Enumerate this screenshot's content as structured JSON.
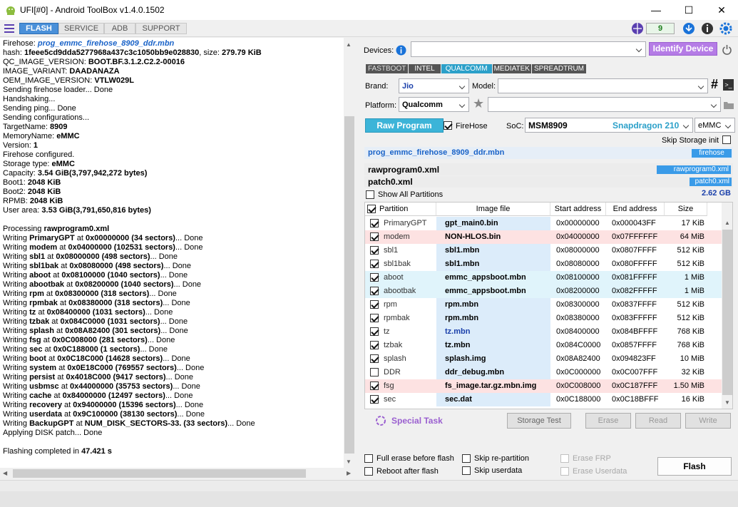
{
  "window": {
    "title": "UFI[#0] - Android ToolBox v1.4.0.1502",
    "controls": [
      "—",
      "☐",
      "✕"
    ]
  },
  "tabs": [
    "FLASH",
    "SERVICE",
    "ADB",
    "SUPPORT"
  ],
  "counter": "9",
  "log": [
    [
      [
        "Firehose: ",
        0
      ],
      [
        "prog_emmc_firehose_8909_ddr.mbn",
        2
      ]
    ],
    [
      [
        " hash: ",
        0
      ],
      [
        "1feee5cd9dda5277968a437c3c1050bb9e028830",
        1
      ],
      [
        ", size: ",
        0
      ],
      [
        "279.79 KiB",
        1
      ]
    ],
    [
      [
        " QC_IMAGE_VERSION: ",
        0
      ],
      [
        "BOOT.BF.3.1.2.C2.2-00016",
        1
      ]
    ],
    [
      [
        " IMAGE_VARIANT: ",
        0
      ],
      [
        "DAADANAZA",
        1
      ]
    ],
    [
      [
        " OEM_IMAGE_VERSION: ",
        0
      ],
      [
        "VTLW029L",
        1
      ]
    ],
    [
      [
        "Sending firehose loader... Done",
        0
      ]
    ],
    [
      [
        "Handshaking...",
        0
      ]
    ],
    [
      [
        "Sending ping... Done",
        0
      ]
    ],
    [
      [
        "Sending configurations...",
        0
      ]
    ],
    [
      [
        " TargetName: ",
        0
      ],
      [
        "8909",
        1
      ]
    ],
    [
      [
        " MemoryName: ",
        0
      ],
      [
        "eMMC",
        1
      ]
    ],
    [
      [
        " Version: ",
        0
      ],
      [
        "1",
        1
      ]
    ],
    [
      [
        "Firehose configured.",
        0
      ]
    ],
    [
      [
        "Storage type: ",
        0
      ],
      [
        "eMMC",
        1
      ]
    ],
    [
      [
        "Capacity: ",
        0
      ],
      [
        "3.54 GiB(3,797,942,272 bytes)",
        1
      ]
    ],
    [
      [
        "Boot1: ",
        0
      ],
      [
        "2048 KiB",
        1
      ]
    ],
    [
      [
        "Boot2: ",
        0
      ],
      [
        "2048 KiB",
        1
      ]
    ],
    [
      [
        "RPMB: ",
        0
      ],
      [
        "2048 KiB",
        1
      ]
    ],
    [
      [
        "User area: ",
        0
      ],
      [
        "3.53 GiB(3,791,650,816 bytes)",
        1
      ]
    ],
    [
      [
        "",
        0
      ]
    ],
    [
      [
        "Processing ",
        0
      ],
      [
        "rawprogram0.xml",
        1
      ]
    ],
    [
      [
        " Writing ",
        0
      ],
      [
        "PrimaryGPT",
        1
      ],
      [
        " at ",
        0
      ],
      [
        "0x00000000 (34 sectors)",
        1
      ],
      [
        "... Done",
        0
      ]
    ],
    [
      [
        " Writing ",
        0
      ],
      [
        "modem",
        1
      ],
      [
        " at ",
        0
      ],
      [
        "0x04000000 (102531 sectors)",
        1
      ],
      [
        "... Done",
        0
      ]
    ],
    [
      [
        " Writing ",
        0
      ],
      [
        "sbl1",
        1
      ],
      [
        " at ",
        0
      ],
      [
        "0x08000000 (498 sectors)",
        1
      ],
      [
        "... Done",
        0
      ]
    ],
    [
      [
        " Writing ",
        0
      ],
      [
        "sbl1bak",
        1
      ],
      [
        " at ",
        0
      ],
      [
        "0x08080000 (498 sectors)",
        1
      ],
      [
        "... Done",
        0
      ]
    ],
    [
      [
        " Writing ",
        0
      ],
      [
        "aboot",
        1
      ],
      [
        " at ",
        0
      ],
      [
        "0x08100000 (1040 sectors)",
        1
      ],
      [
        "... Done",
        0
      ]
    ],
    [
      [
        " Writing ",
        0
      ],
      [
        "abootbak",
        1
      ],
      [
        " at ",
        0
      ],
      [
        "0x08200000 (1040 sectors)",
        1
      ],
      [
        "... Done",
        0
      ]
    ],
    [
      [
        " Writing ",
        0
      ],
      [
        "rpm",
        1
      ],
      [
        " at ",
        0
      ],
      [
        "0x08300000 (318 sectors)",
        1
      ],
      [
        "... Done",
        0
      ]
    ],
    [
      [
        " Writing ",
        0
      ],
      [
        "rpmbak",
        1
      ],
      [
        " at ",
        0
      ],
      [
        "0x08380000 (318 sectors)",
        1
      ],
      [
        "... Done",
        0
      ]
    ],
    [
      [
        " Writing ",
        0
      ],
      [
        "tz",
        1
      ],
      [
        " at ",
        0
      ],
      [
        "0x08400000 (1031 sectors)",
        1
      ],
      [
        "... Done",
        0
      ]
    ],
    [
      [
        " Writing ",
        0
      ],
      [
        "tzbak",
        1
      ],
      [
        " at ",
        0
      ],
      [
        "0x084C0000 (1031 sectors)",
        1
      ],
      [
        "... Done",
        0
      ]
    ],
    [
      [
        " Writing ",
        0
      ],
      [
        "splash",
        1
      ],
      [
        " at ",
        0
      ],
      [
        "0x08A82400 (301 sectors)",
        1
      ],
      [
        "... Done",
        0
      ]
    ],
    [
      [
        " Writing ",
        0
      ],
      [
        "fsg",
        1
      ],
      [
        " at ",
        0
      ],
      [
        "0x0C008000 (281 sectors)",
        1
      ],
      [
        "... Done",
        0
      ]
    ],
    [
      [
        " Writing ",
        0
      ],
      [
        "sec",
        1
      ],
      [
        " at ",
        0
      ],
      [
        "0x0C188000 (1 sectors)",
        1
      ],
      [
        "... Done",
        0
      ]
    ],
    [
      [
        " Writing ",
        0
      ],
      [
        "boot",
        1
      ],
      [
        " at ",
        0
      ],
      [
        "0x0C18C000 (14628 sectors)",
        1
      ],
      [
        "... Done",
        0
      ]
    ],
    [
      [
        " Writing ",
        0
      ],
      [
        "system",
        1
      ],
      [
        " at ",
        0
      ],
      [
        "0x0E18C000 (769557 sectors)",
        1
      ],
      [
        "... Done",
        0
      ]
    ],
    [
      [
        " Writing ",
        0
      ],
      [
        "persist",
        1
      ],
      [
        " at ",
        0
      ],
      [
        "0x4018C000 (9417 sectors)",
        1
      ],
      [
        "... Done",
        0
      ]
    ],
    [
      [
        " Writing ",
        0
      ],
      [
        "usbmsc",
        1
      ],
      [
        " at ",
        0
      ],
      [
        "0x44000000 (35753 sectors)",
        1
      ],
      [
        "... Done",
        0
      ]
    ],
    [
      [
        " Writing ",
        0
      ],
      [
        "cache",
        1
      ],
      [
        " at ",
        0
      ],
      [
        "0x84000000 (12497 sectors)",
        1
      ],
      [
        "... Done",
        0
      ]
    ],
    [
      [
        " Writing ",
        0
      ],
      [
        "recovery",
        1
      ],
      [
        " at ",
        0
      ],
      [
        "0x94000000 (15396 sectors)",
        1
      ],
      [
        "... Done",
        0
      ]
    ],
    [
      [
        " Writing ",
        0
      ],
      [
        "userdata",
        1
      ],
      [
        " at ",
        0
      ],
      [
        "0x9C100000 (38130 sectors)",
        1
      ],
      [
        "... Done",
        0
      ]
    ],
    [
      [
        " Writing ",
        0
      ],
      [
        "BackupGPT",
        1
      ],
      [
        " at ",
        0
      ],
      [
        "NUM_DISK_SECTORS-33. (33 sectors)",
        1
      ],
      [
        "... Done",
        0
      ]
    ],
    [
      [
        " Applying DISK patch... Done",
        0
      ]
    ],
    [
      [
        "",
        0
      ]
    ],
    [
      [
        "Flashing completed in ",
        0
      ],
      [
        "47.421 s",
        1
      ]
    ]
  ],
  "devices": {
    "label": "Devices:",
    "value": "",
    "identify": "Identify Device"
  },
  "chip_tabs": [
    "FASTBOOT",
    "INTEL",
    "QUALCOMM",
    "MEDIATEK",
    "SPREADTRUM"
  ],
  "brand": {
    "label": "Brand:",
    "value": "Jio"
  },
  "model": {
    "label": "Model:",
    "value": ""
  },
  "platform": {
    "label": "Platform:",
    "value": "Qualcomm"
  },
  "raw_program": "Raw Program",
  "firehose_chk": "FireHose",
  "soc": {
    "label": "SoC:",
    "value": "MSM8909",
    "chip": "Snapdragon 210",
    "storage": "eMMC"
  },
  "skip_storage": "Skip Storage init",
  "files": {
    "firehose": {
      "name": "prog_emmc_firehose_8909_ddr.mbn",
      "tag": "firehose"
    },
    "rawprogram": {
      "name": "rawprogram0.xml",
      "tag": "rawprogram0.xml"
    },
    "patch": {
      "name": "patch0.xml",
      "tag": "patch0.xml"
    }
  },
  "show_all": "Show All Partitions",
  "total_size": "2.62 GB",
  "table": {
    "headers": [
      "Partition",
      "Image file",
      "Start address",
      "End address",
      "Size"
    ],
    "rows": [
      {
        "p": "PrimaryGPT",
        "i": "gpt_main0.bin",
        "s": "0x00000000",
        "e": "0x000043FF",
        "z": "17 KiB",
        "on": true,
        "bg": "#ffffff",
        "ib": "#dcecfa",
        "ic": "#000000"
      },
      {
        "p": "modem",
        "i": "NON-HLOS.bin",
        "s": "0x04000000",
        "e": "0x07FFFFFF",
        "z": "64 MiB",
        "on": true,
        "bg": "#fde2e2",
        "ib": "#fde2e2",
        "ic": "#000000"
      },
      {
        "p": "sbl1",
        "i": "sbl1.mbn",
        "s": "0x08000000",
        "e": "0x0807FFFF",
        "z": "512 KiB",
        "on": true,
        "bg": "#ffffff",
        "ib": "#dcecfa",
        "ic": "#000000"
      },
      {
        "p": "sbl1bak",
        "i": "sbl1.mbn",
        "s": "0x08080000",
        "e": "0x080FFFFF",
        "z": "512 KiB",
        "on": true,
        "bg": "#ffffff",
        "ib": "#dcecfa",
        "ic": "#000000"
      },
      {
        "p": "aboot",
        "i": "emmc_appsboot.mbn",
        "s": "0x08100000",
        "e": "0x081FFFFF",
        "z": "1 MiB",
        "on": true,
        "bg": "#e0f4fb",
        "ib": "#e0f4fb",
        "ic": "#000000"
      },
      {
        "p": "abootbak",
        "i": "emmc_appsboot.mbn",
        "s": "0x08200000",
        "e": "0x082FFFFF",
        "z": "1 MiB",
        "on": true,
        "bg": "#e0f4fb",
        "ib": "#e0f4fb",
        "ic": "#000000"
      },
      {
        "p": "rpm",
        "i": "rpm.mbn",
        "s": "0x08300000",
        "e": "0x0837FFFF",
        "z": "512 KiB",
        "on": true,
        "bg": "#ffffff",
        "ib": "#dcecfa",
        "ic": "#000000"
      },
      {
        "p": "rpmbak",
        "i": "rpm.mbn",
        "s": "0x08380000",
        "e": "0x083FFFFF",
        "z": "512 KiB",
        "on": true,
        "bg": "#ffffff",
        "ib": "#dcecfa",
        "ic": "#000000"
      },
      {
        "p": "tz",
        "i": "tz.mbn",
        "s": "0x08400000",
        "e": "0x084BFFFF",
        "z": "768 KiB",
        "on": true,
        "bg": "#ffffff",
        "ib": "#dcecfa",
        "ic": "#1a3faa"
      },
      {
        "p": "tzbak",
        "i": "tz.mbn",
        "s": "0x084C0000",
        "e": "0x0857FFFF",
        "z": "768 KiB",
        "on": true,
        "bg": "#ffffff",
        "ib": "#dcecfa",
        "ic": "#000000"
      },
      {
        "p": "splash",
        "i": "splash.img",
        "s": "0x08A82400",
        "e": "0x094823FF",
        "z": "10 MiB",
        "on": true,
        "bg": "#ffffff",
        "ib": "#dcecfa",
        "ic": "#000000"
      },
      {
        "p": "DDR",
        "i": "ddr_debug.mbn",
        "s": "0x0C000000",
        "e": "0x0C007FFF",
        "z": "32 KiB",
        "on": false,
        "bg": "#ffffff",
        "ib": "#dcecfa",
        "ic": "#000000"
      },
      {
        "p": "fsg",
        "i": "fs_image.tar.gz.mbn.img",
        "s": "0x0C008000",
        "e": "0x0C187FFF",
        "z": "1.50 MiB",
        "on": true,
        "bg": "#fde2e2",
        "ib": "#fde2e2",
        "ic": "#000000"
      },
      {
        "p": "sec",
        "i": "sec.dat",
        "s": "0x0C188000",
        "e": "0x0C18BFFF",
        "z": "16 KiB",
        "on": true,
        "bg": "#ffffff",
        "ib": "#dcecfa",
        "ic": "#000000"
      }
    ]
  },
  "special_task": "Special Task",
  "actions": [
    "Storage Test",
    "Erase",
    "Read",
    "Write"
  ],
  "options": {
    "full_erase": "Full erase before flash",
    "reboot": "Reboot after flash",
    "skip_repart": "Skip re-partition",
    "skip_userdata": "Skip userdata",
    "erase_frp": "Erase FRP",
    "erase_userdata": "Erase Userdata"
  },
  "flash_button": "Flash",
  "colors": {
    "accent": "#4a90d9",
    "identify": "#b57ce6",
    "badge": "#3a9be8",
    "link": "#1a63c8"
  }
}
